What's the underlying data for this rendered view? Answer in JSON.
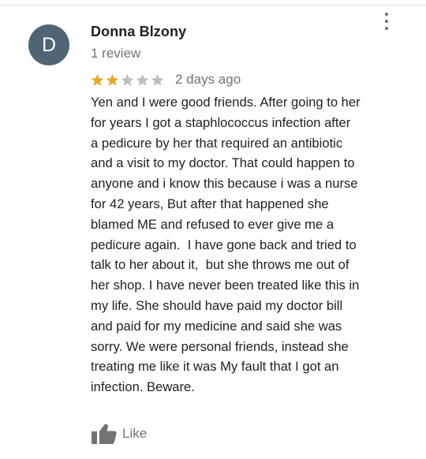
{
  "review": {
    "avatar_initial": "D",
    "avatar_color": "#4f6573",
    "reviewer_name": "Donna Blzony",
    "review_count": "1 review",
    "rating": 2,
    "rating_max": 5,
    "star_filled_color": "#e7a92b",
    "star_empty_color": "#bdbdbd",
    "date": "2 days ago",
    "text": "Yen and I were good friends. After going to her\nfor years I got a staphlococcus infection after\na pedicure by her that required an antibiotic\nand a visit to my doctor. That could happen to\nanyone and i know this because i was a nurse\nfor 42 years, But after that happened she\nblamed ME and refused to ever give me a\npedicure again.  I have gone back and tried to\ntalk to her about it,  but she throws me out of\nher shop. I have never been treated like this in\nmy life. She should have paid my doctor bill\nand paid for my medicine and said she was\nsorry. We were personal friends, instead she\ntreating me like it was My fault that I got an\ninfection. Beware."
  },
  "actions": {
    "like_label": "Like",
    "like_icon": "thumbs-up-icon",
    "more_icon": "more-vert-icon"
  }
}
